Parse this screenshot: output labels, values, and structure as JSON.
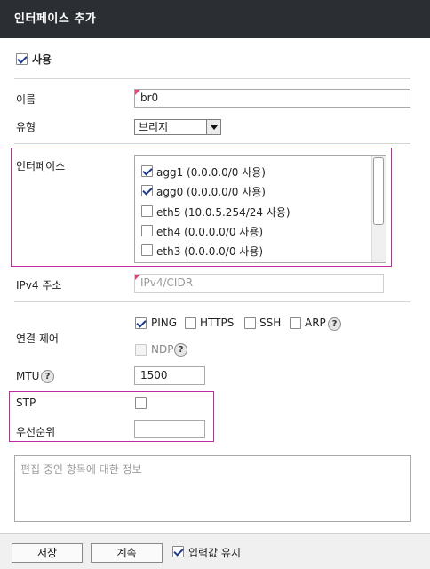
{
  "title": "인터페이스 추가",
  "enable": {
    "label": "사용",
    "checked": true
  },
  "name": {
    "label": "이름",
    "value": "br0"
  },
  "type": {
    "label": "유형",
    "selected": "브리지"
  },
  "interfaces": {
    "label": "인터페이스",
    "items": [
      {
        "label": "agg1 (0.0.0.0/0 사용)",
        "checked": true
      },
      {
        "label": "agg0 (0.0.0.0/0 사용)",
        "checked": true
      },
      {
        "label": "eth5 (10.0.5.254/24 사용)",
        "checked": false
      },
      {
        "label": "eth4 (0.0.0.0/0 사용)",
        "checked": false
      },
      {
        "label": "eth3 (0.0.0.0/0 사용)",
        "checked": false
      }
    ]
  },
  "ipv4": {
    "label": "IPv4 주소",
    "placeholder": "IPv4/CIDR"
  },
  "conn": {
    "label": "연결 제어",
    "ping": "PING",
    "https": "HTTPS",
    "ssh": "SSH",
    "arp": "ARP",
    "ndp": "NDP"
  },
  "mtu": {
    "label": "MTU",
    "value": "1500"
  },
  "stp": {
    "label": "STP"
  },
  "priority": {
    "label": "우선순위",
    "value": ""
  },
  "help_glyph": "?",
  "info_text": "편집 중인 항목에 대한 정보",
  "footer": {
    "save": "저장",
    "continue": "계속",
    "keep_input": "입력값 유지"
  }
}
